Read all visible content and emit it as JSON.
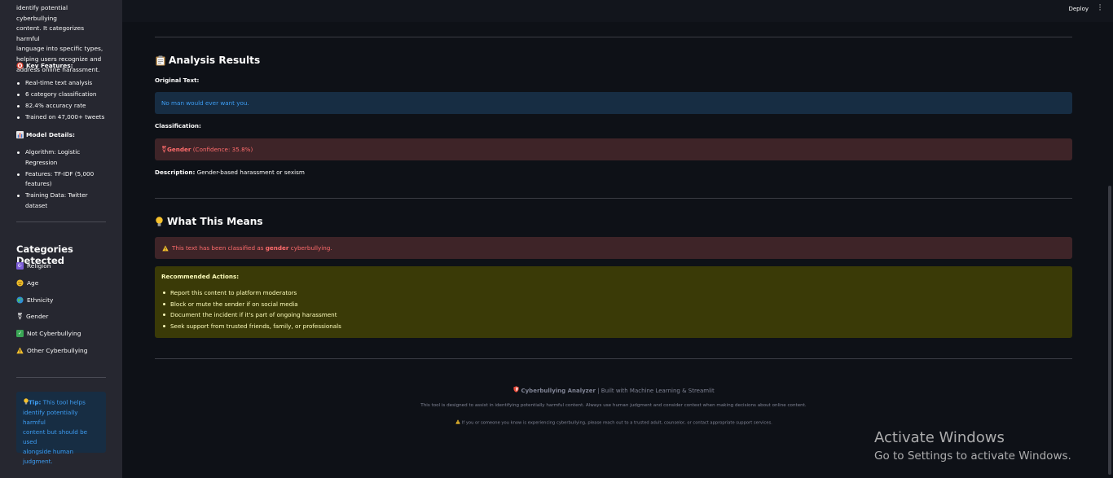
{
  "sidebar": {
    "intro_lines": [
      "identify potential cyberbullying",
      "content. It categorizes harmful",
      "language into specific types,",
      "helping users recognize and",
      "address online harassment."
    ],
    "key_features_heading": "Key Features:",
    "key_features": [
      "Real-time text analysis",
      "6 category classification",
      "82.4% accuracy rate",
      "Trained on 47,000+ tweets"
    ],
    "model_details_heading": "Model Details:",
    "model_details": [
      {
        "line1": "Algorithm: Logistic",
        "line2": "Regression"
      },
      {
        "line1": "Features: TF-IDF (5,000",
        "line2": "features)"
      },
      {
        "line1": "Training Data: Twitter dataset",
        "line2": ""
      }
    ],
    "categories_title": "Categories Detected",
    "categories": [
      "Religion",
      "Age",
      "Ethnicity",
      "Gender",
      "Not Cyberbullying",
      "Other Cyberbullying"
    ],
    "tip": {
      "prefix": "Tip:",
      "line1": " This tool helps",
      "line2": "identify potentially harmful",
      "line3": "content but should be used",
      "line4": "alongside human",
      "line5": "judgment."
    }
  },
  "header": {
    "deploy_label": "Deploy",
    "menu_icon": "⋮"
  },
  "analysis": {
    "title": "Analysis Results",
    "original_text_label": "Original Text:",
    "original_text": "No man would ever want you.",
    "classification_label": "Classification:",
    "class_name": "Gender",
    "confidence_text": " (Confidence: 35.8%)",
    "description_label": "Description:",
    "description": " Gender-based harassment or sexism"
  },
  "meaning": {
    "title": "What This Means",
    "warning_prefix": "This text has been classified as ",
    "warning_category": "gender",
    "warning_suffix": " cyberbullying.",
    "recommended_title": "Recommended Actions:",
    "actions": [
      "Report this content to platform moderators",
      "Block or mute the sender if on social media",
      "Document the incident if it's part of ongoing harassment",
      "Seek support from trusted friends, family, or professionals"
    ]
  },
  "footer": {
    "app_name": "Cyberbullying Analyzer",
    "built_with": " | Built with Machine Learning & Streamlit",
    "disclaimer": "This tool is designed to assist in identifying potentially harmful content. Always use human judgment and consider context when making decisions about online content.",
    "support_note": "If you or someone you know is experiencing cyberbullying, please reach out to a trusted adult, counselor, or contact appropriate support services."
  },
  "watermark": {
    "line1": "Activate Windows",
    "line2": "Go to Settings to activate Windows."
  },
  "colors": {
    "sidebar_bg": "#262730",
    "main_bg": "#0e1117",
    "info_bg": "#172d43",
    "info_text": "#3d9df3",
    "error_bg": "#3e2428",
    "error_text": "#ff6c6c",
    "warning_bg": "#3a3a07",
    "warning_text": "#fdfdbd"
  },
  "icons": {
    "key_features": "target-icon",
    "model_details": "bar-chart-icon",
    "analysis": "clipboard-icon",
    "meaning": "lightbulb-icon",
    "tip": "lightbulb-icon",
    "warning": "warning-icon",
    "gender": "gender-symbol-icon",
    "religion": "religion-icon",
    "age": "face-icon",
    "ethnicity": "globe-icon",
    "not_cyberbullying": "check-icon",
    "footer_shield": "shield-icon"
  }
}
